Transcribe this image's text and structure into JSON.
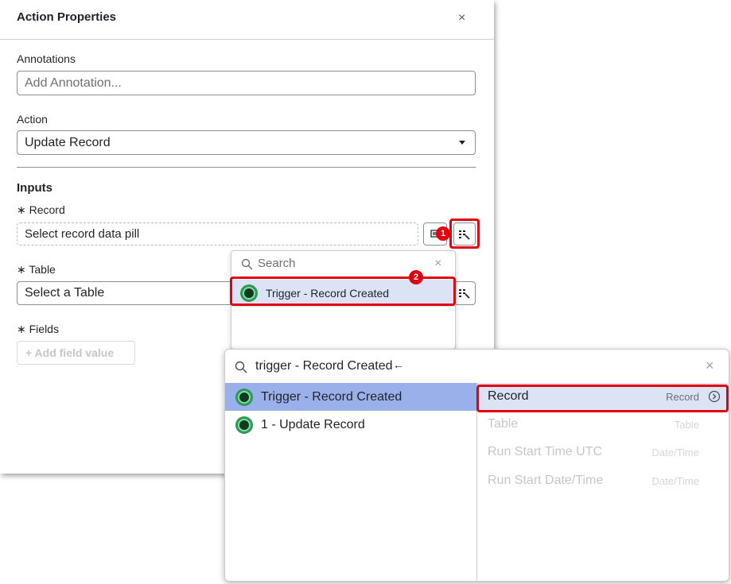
{
  "panel": {
    "title": "Action Properties",
    "close_glyph": "×",
    "annotations_label": "Annotations",
    "annotations_placeholder": "Add Annotation...",
    "action_label": "Action",
    "action_value": "Update Record",
    "inputs_title": "Inputs",
    "record_label": "∗ Record",
    "record_placeholder": "Select record data pill",
    "table_label": "∗ Table",
    "table_placeholder": "Select a Table",
    "fields_label": "∗ Fields",
    "add_field_label": "+ Add field value"
  },
  "callouts": {
    "one": "1",
    "two": "2"
  },
  "search_popup": {
    "placeholder": "Search",
    "close_glyph": "×",
    "item": "Trigger - Record Created"
  },
  "picker": {
    "query": "trigger - Record Created",
    "close_glyph": "×",
    "left_items": [
      "Trigger - Record Created",
      "1 - Update Record"
    ],
    "right_items": [
      {
        "name": "Record",
        "type": "Record"
      },
      {
        "name": "Table",
        "type": "Table"
      },
      {
        "name": "Run Start Time UTC",
        "type": "Date/Time"
      },
      {
        "name": "Run Start Date/Time",
        "type": "Date/Time"
      }
    ]
  },
  "colors": {
    "highlight": "#e2000f",
    "selected_left": "#9ab0ea",
    "selected_light": "#dbe3f5",
    "pill_green": "#2b9a56"
  }
}
